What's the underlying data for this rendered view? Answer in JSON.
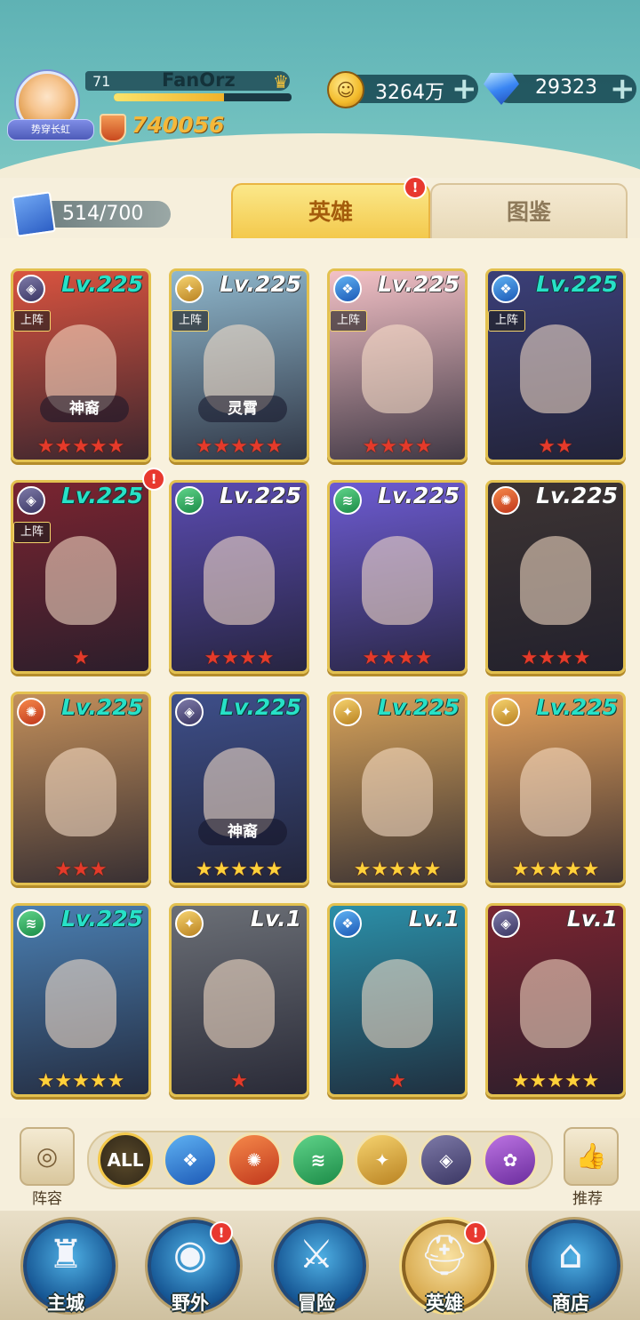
{
  "header": {
    "player_level": "71",
    "player_name": "FanOrz",
    "avatar_title": "势穿长虹",
    "exp_progress": 0.62,
    "power": "740056",
    "gold": "3264万",
    "gems": "29323"
  },
  "tabs": {
    "hero_count": "514/700",
    "heroes_label": "英雄",
    "book_label": "图鉴",
    "heroes_badge": "!"
  },
  "icons": {
    "plus": "+",
    "crown": "♛",
    "star": "★"
  },
  "heroes": [
    {
      "faction": "void",
      "level": "Lv.225",
      "level_color": "teal",
      "deployed": "上阵",
      "tag": "神裔",
      "stars": "★★★★★",
      "star_color": "red",
      "bg": "#d9533f"
    },
    {
      "faction": "light",
      "level": "Lv.225",
      "level_color": "white",
      "deployed": "上阵",
      "tag": "灵霄",
      "stars": "★★★★★",
      "star_color": "red",
      "bg": "#8fb7cc"
    },
    {
      "faction": "water",
      "level": "Lv.225",
      "level_color": "white",
      "deployed": "上阵",
      "tag": "",
      "stars": "★★★★",
      "star_color": "red",
      "bg": "#f3c1c6"
    },
    {
      "faction": "water",
      "level": "Lv.225",
      "level_color": "teal",
      "deployed": "上阵",
      "tag": "",
      "stars": "★★",
      "star_color": "red",
      "bg": "#3b3f78"
    },
    {
      "faction": "void",
      "level": "Lv.225",
      "level_color": "teal",
      "deployed": "上阵",
      "tag": "",
      "stars": "★",
      "star_color": "red",
      "bg": "#7a2430",
      "badge": "!"
    },
    {
      "faction": "wind",
      "level": "Lv.225",
      "level_color": "white",
      "deployed": "",
      "tag": "",
      "stars": "★★★★",
      "star_color": "red",
      "bg": "#5a4bb0"
    },
    {
      "faction": "wind",
      "level": "Lv.225",
      "level_color": "white",
      "deployed": "",
      "tag": "",
      "stars": "★★★★",
      "star_color": "red",
      "bg": "#6d5bd2"
    },
    {
      "faction": "fire",
      "level": "Lv.225",
      "level_color": "white",
      "deployed": "",
      "tag": "",
      "stars": "★★★★",
      "star_color": "red",
      "bg": "#3d3433"
    },
    {
      "faction": "fire",
      "level": "Lv.225",
      "level_color": "teal",
      "deployed": "",
      "tag": "",
      "stars": "★★★",
      "star_color": "red",
      "bg": "#c38f5a"
    },
    {
      "faction": "void",
      "level": "Lv.225",
      "level_color": "teal",
      "deployed": "",
      "tag": "神裔",
      "stars": "★★★★★",
      "star_color": "gold",
      "bg": "#3e4f8a"
    },
    {
      "faction": "light",
      "level": "Lv.225",
      "level_color": "teal",
      "deployed": "",
      "tag": "",
      "stars": "★★★★★",
      "star_color": "gold",
      "bg": "#d8a35a"
    },
    {
      "faction": "light",
      "level": "Lv.225",
      "level_color": "teal",
      "deployed": "",
      "tag": "",
      "stars": "★★★★★",
      "star_color": "gold",
      "bg": "#e5a15a"
    },
    {
      "faction": "wind",
      "level": "Lv.225",
      "level_color": "teal",
      "deployed": "",
      "tag": "",
      "stars": "★★★★★",
      "star_color": "gold",
      "bg": "#4a7fb2"
    },
    {
      "faction": "light",
      "level": "Lv.1",
      "level_color": "white",
      "deployed": "",
      "tag": "",
      "stars": "★",
      "star_color": "red",
      "bg": "#6b6f76"
    },
    {
      "faction": "water",
      "level": "Lv.1",
      "level_color": "white",
      "deployed": "",
      "tag": "",
      "stars": "★",
      "star_color": "red",
      "bg": "#2b8fa8"
    },
    {
      "faction": "void",
      "level": "Lv.1",
      "level_color": "white",
      "deployed": "",
      "tag": "",
      "stars": "★★★★★",
      "star_color": "gold",
      "bg": "#7a2430"
    }
  ],
  "filters": {
    "lineup_label": "阵容",
    "recommend_label": "推荐",
    "all_label": "ALL",
    "items": [
      "all",
      "water",
      "fire",
      "wind",
      "light",
      "void",
      "dark"
    ]
  },
  "nav": {
    "items": [
      {
        "label": "主城",
        "glyph": "♜",
        "active": false,
        "badge": ""
      },
      {
        "label": "野外",
        "glyph": "◉",
        "active": false,
        "badge": "!"
      },
      {
        "label": "冒险",
        "glyph": "⚔",
        "active": false,
        "badge": ""
      },
      {
        "label": "英雄",
        "glyph": "⛑",
        "active": true,
        "badge": "!"
      },
      {
        "label": "商店",
        "glyph": "⌂",
        "active": false,
        "badge": ""
      }
    ]
  },
  "colors": {
    "teal_level": "#27e1c7",
    "tab_active": "#f3c84a",
    "badge_red": "#e8382f"
  }
}
